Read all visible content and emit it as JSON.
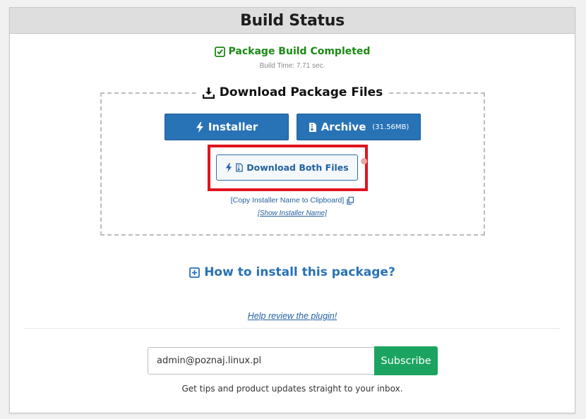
{
  "header": {
    "title": "Build Status"
  },
  "status": {
    "text": "Package Build Completed",
    "build_time": "Build Time: 7.71 sec.",
    "color": "#1a8a14"
  },
  "download": {
    "legend": "Download Package Files",
    "installer_label": "Installer",
    "archive_label": "Archive",
    "archive_size": "(31.56MB)",
    "both_label": "Download Both Files",
    "copy_link": "[Copy Installer Name to Clipboard]",
    "show_link": "[Show Installer Name]",
    "button_color": "#2872b6",
    "highlight_color": "#e0141e"
  },
  "howto": {
    "label": "How to install this package?"
  },
  "review": {
    "label": "Help review the plugin!"
  },
  "subscribe": {
    "email_value": "admin@poznaj.linux.pl",
    "button_label": "Subscribe",
    "tips": "Get tips and product updates straight to your inbox.",
    "button_color": "#1ba460"
  },
  "icons": {
    "check": "check-square-icon",
    "download": "download-icon",
    "bolt": "bolt-icon",
    "archive": "file-archive-icon",
    "copy": "copy-icon",
    "plus": "plus-square-icon"
  }
}
